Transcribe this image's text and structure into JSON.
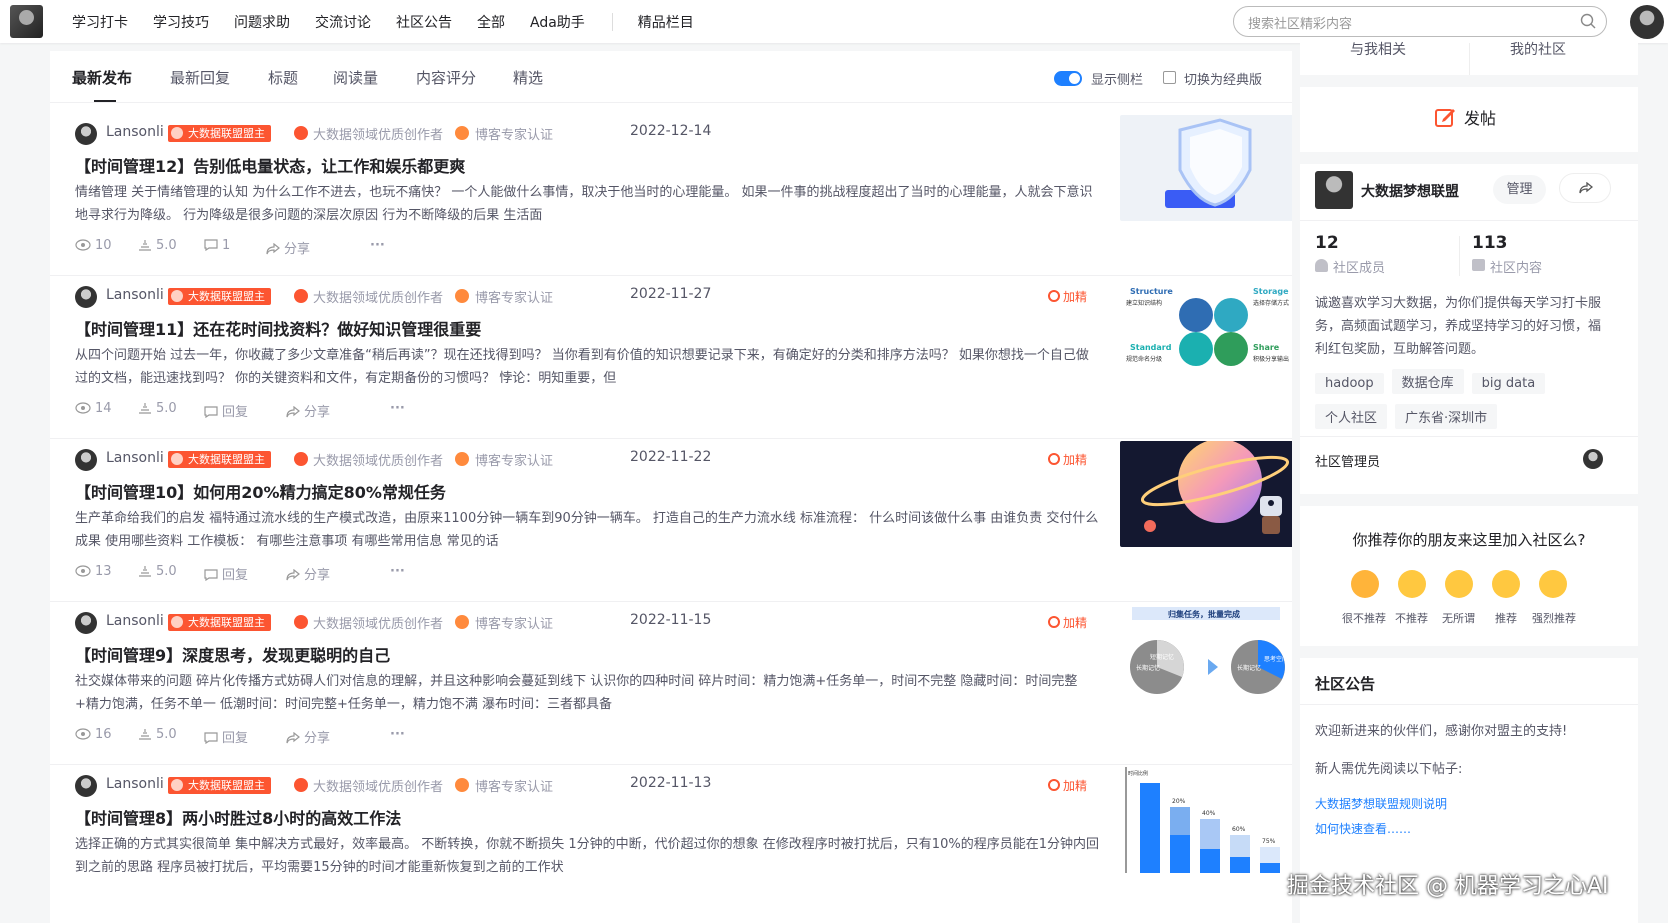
{
  "nav": {
    "items": [
      "学习打卡",
      "学习技巧",
      "问题求助",
      "交流讨论",
      "社区公告",
      "全部",
      "Ada助手"
    ],
    "featured": "精品栏目"
  },
  "search": {
    "placeholder": "搜索社区精彩内容"
  },
  "tabs": [
    "最新发布",
    "最新回复",
    "标题",
    "阅读量",
    "内容评分",
    "精选"
  ],
  "view": {
    "toggle_label": "显示侧栏",
    "classic_label": "切换为经典版"
  },
  "posts": [
    {
      "author": "Lansonli",
      "badge": "大数据联盟盟主",
      "cert1": "大数据领域优质创作者",
      "cert2": "博客专家认证",
      "date": "2022-12-14",
      "jia": "",
      "title": "【时间管理12】告别低电量状态，让工作和娱乐都更爽",
      "desc": "情绪管理 关于情绪管理的认知 为什么工作不进去，也玩不痛快？ 一个人能做什么事情，取决于他当时的心理能量。 如果一件事的挑战程度超出了当时的心理能量，人就会下意识地寻求行为降级。 行为降级是很多问题的深层次原因 行为不断降级的后果 生活面",
      "views": "10",
      "score": "5.0",
      "reply": "1",
      "share": "分享",
      "more": "···"
    },
    {
      "author": "Lansonli",
      "badge": "大数据联盟盟主",
      "cert1": "大数据领域优质创作者",
      "cert2": "博客专家认证",
      "date": "2022-11-27",
      "jia": "加精",
      "title": "【时间管理11】还在花时间找资料？做好知识管理很重要",
      "desc": "从四个问题开始 过去一年，你收藏了多少文章准备“稍后再读”？现在还找得到吗？ 当你看到有价值的知识想要记录下来，有确定好的分类和排序方法吗？ 如果你想找一个自己做过的文档，能迅速找到吗？ 你的关键资料和文件，有定期备份的习惯吗？ 悖论：明知重要，但",
      "views": "14",
      "score": "5.0",
      "reply": "回复",
      "share": "分享",
      "more": "···"
    },
    {
      "author": "Lansonli",
      "badge": "大数据联盟盟主",
      "cert1": "大数据领域优质创作者",
      "cert2": "博客专家认证",
      "date": "2022-11-22",
      "jia": "加精",
      "title": "【时间管理10】如何用20%精力搞定80%常规任务",
      "desc": "生产革命给我们的启发 福特通过流水线的生产模式改造，由原来1100分钟一辆车到90分钟一辆车。 打造自己的生产力流水线 标准流程： 什么时间该做什么事 由谁负责 交付什么成果 使用哪些资料 工作模板： 有哪些注意事项 有哪些常用信息 常见的话",
      "views": "13",
      "score": "5.0",
      "reply": "回复",
      "share": "分享",
      "more": "···"
    },
    {
      "author": "Lansonli",
      "badge": "大数据联盟盟主",
      "cert1": "大数据领域优质创作者",
      "cert2": "博客专家认证",
      "date": "2022-11-15",
      "jia": "加精",
      "title": "【时间管理9】深度思考，发现更聪明的自己",
      "desc": "社交媒体带来的问题 碎片化传播方式妨碍人们对信息的理解，并且这种影响会蔓延到线下 认识你的四种时间 碎片时间：精力饱满+任务单一，时间不完整 隐藏时间：时间完整+精力饱满，任务不单一 低潮时间：时间完整+任务单一，精力饱不满 瀑布时间：三者都具备",
      "views": "16",
      "score": "5.0",
      "reply": "回复",
      "share": "分享",
      "more": "···"
    },
    {
      "author": "Lansonli",
      "badge": "大数据联盟盟主",
      "cert1": "大数据领域优质创作者",
      "cert2": "博客专家认证",
      "date": "2022-11-13",
      "jia": "加精",
      "title": "【时间管理8】两小时胜过8小时的高效工作法",
      "desc": "选择正确的方式其实很简单 集中解决方式最好，效率最高。 不断转换，你就不断损失 1分钟的中断，代价超过你的想象 在修改程序时被打扰后，只有10%的程序员能在1分钟内回到之前的思路 程序员被打扰后，平均需要15分钟的时间才能重新恢复到之前的工作状",
      "views": "",
      "score": "",
      "reply": "",
      "share": "",
      "more": ""
    }
  ],
  "thumbs": {
    "t2": {
      "structure": "Structure",
      "structure_cn": "建立知识结构",
      "storage": "Storage",
      "storage_cn": "选择存储方式",
      "standard": "Standard",
      "standard_cn": "规范命名分级",
      "share": "Share",
      "share_cn": "积极分享输出"
    },
    "t4": {
      "banner": "归集任务，批量完成",
      "c1": "短期记忆",
      "c2": "长期记忆",
      "c3": "长期记忆",
      "c4": "思考空间"
    },
    "t5": {
      "axis": "时间比例",
      "p1": "20%",
      "p2": "40%",
      "p3": "60%",
      "p4": "75%"
    }
  },
  "sidebar": {
    "top_tabs": [
      "与我相关",
      "我的社区"
    ],
    "post_button": "发帖",
    "community": {
      "name": "大数据梦想联盟",
      "manage": "管理",
      "members_count": "12",
      "members_label": "社区成员",
      "content_count": "113",
      "content_label": "社区内容",
      "desc": "诚邀喜欢学习大数据，为你们提供每天学习打卡服务，高频面试题学习，养成坚持学习的好习惯，福利红包奖励，互助解答问题。",
      "tags": [
        "hadoop",
        "数据仓库",
        "big data",
        "个人社区",
        "广东省·深圳市"
      ],
      "admin_label": "社区管理员"
    },
    "recommend": {
      "question": "你推荐你的朋友来这里加入社区么?",
      "options": [
        "很不推荐",
        "不推荐",
        "无所谓",
        "推荐",
        "强烈推荐"
      ]
    },
    "notice": {
      "title": "社区公告",
      "line1": "欢迎新进来的伙伴们，感谢你对盟主的支持!",
      "line2": "新人需优先阅读以下帖子:",
      "link1": "大数据梦想联盟规则说明",
      "link2": "如何快速查看……"
    }
  },
  "watermark": "掘金技术社区 @ 机器学习之心AI",
  "colors": {
    "accent": "#1e80ff",
    "badge": "#fc5531",
    "text": "#222226",
    "muted": "#999aaa"
  }
}
